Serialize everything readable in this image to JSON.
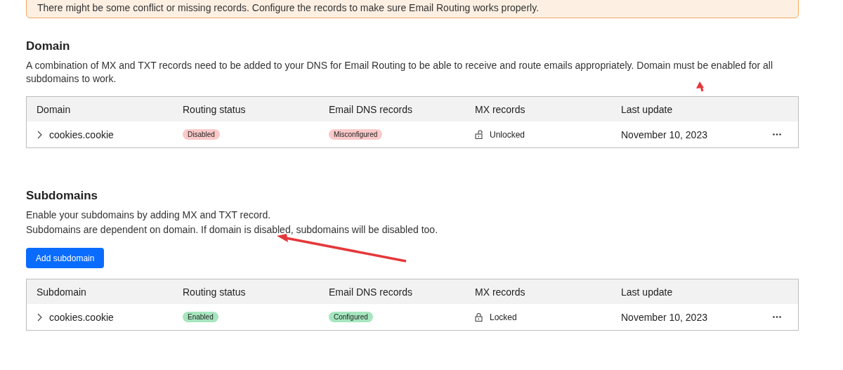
{
  "alert": {
    "message": "There might be some conflict or missing records. Configure the records to make sure Email Routing works properly."
  },
  "sections": [
    {
      "title": "Domain",
      "description": [
        "A combination of MX and TXT records need to be added to your DNS for Email Routing to be able to receive and route emails appropriately. Domain must be enabled for all subdomains to work."
      ],
      "columns": [
        "Domain",
        "Routing status",
        "Email DNS records",
        "MX records",
        "Last update"
      ],
      "rows": [
        {
          "name": "cookies.cookie",
          "expanded": false,
          "routing_status": {
            "label": "Disabled",
            "kind": "danger"
          },
          "dns_records": {
            "label": "Misconfigured",
            "kind": "danger"
          },
          "mx_records": {
            "label": "Unlocked",
            "locked": false
          },
          "last_update": "November 10, 2023"
        }
      ]
    },
    {
      "title": "Subdomains",
      "description": [
        "Enable your subdomains by adding MX and TXT record.",
        "Subdomains are dependent on domain. If domain is disabled, subdomains will be disabled too."
      ],
      "button": "Add subdomain",
      "columns": [
        "Subdomain",
        "Routing status",
        "Email DNS records",
        "MX records",
        "Last update"
      ],
      "rows": [
        {
          "name": "cookies.cookie",
          "expanded": false,
          "routing_status": {
            "label": "Enabled",
            "kind": "success"
          },
          "dns_records": {
            "label": "Configured",
            "kind": "success"
          },
          "mx_records": {
            "label": "Locked",
            "locked": true
          },
          "last_update": "November 10, 2023"
        }
      ]
    }
  ]
}
